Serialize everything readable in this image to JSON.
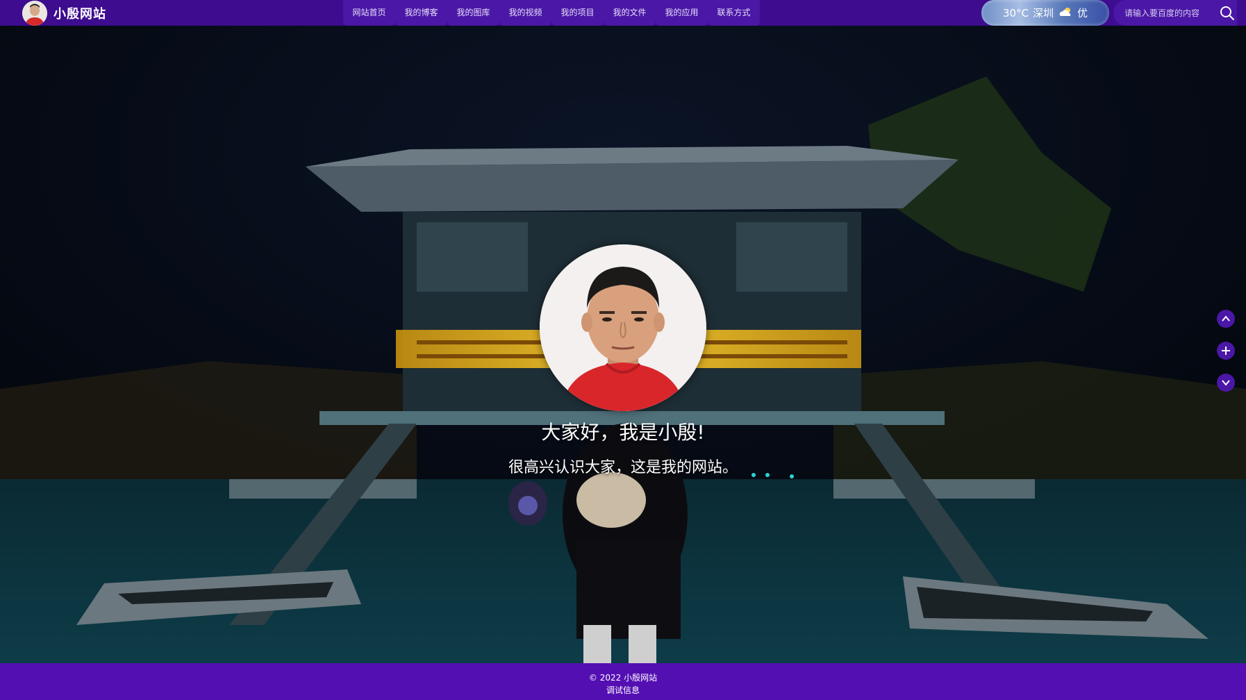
{
  "site": {
    "name": "小殷网站"
  },
  "nav": {
    "items": [
      {
        "label": "网站首页"
      },
      {
        "label": "我的博客"
      },
      {
        "label": "我的图库"
      },
      {
        "label": "我的视频"
      },
      {
        "label": "我的项目"
      },
      {
        "label": "我的文件"
      },
      {
        "label": "我的应用"
      },
      {
        "label": "联系方式"
      }
    ]
  },
  "weather": {
    "temperature": "30°C",
    "city": "深圳",
    "air_quality": "优",
    "icon": "cloud-icon"
  },
  "search": {
    "placeholder": "请输入要百度的内容",
    "icon": "search-icon"
  },
  "hero": {
    "greeting": "大家好，我是小殷!",
    "subtitle": "很高兴认识大家，这是我的网站。"
  },
  "side_controls": {
    "icons": [
      "chevron-up-icon",
      "plus-icon",
      "chevron-down-icon"
    ]
  },
  "footer": {
    "copyright": "© 2022 小殷网站",
    "debug_link": "调试信息"
  },
  "colors": {
    "topbar": "#3d0c8f",
    "nav_item": "#4a17a6",
    "footer": "#540fb3"
  }
}
